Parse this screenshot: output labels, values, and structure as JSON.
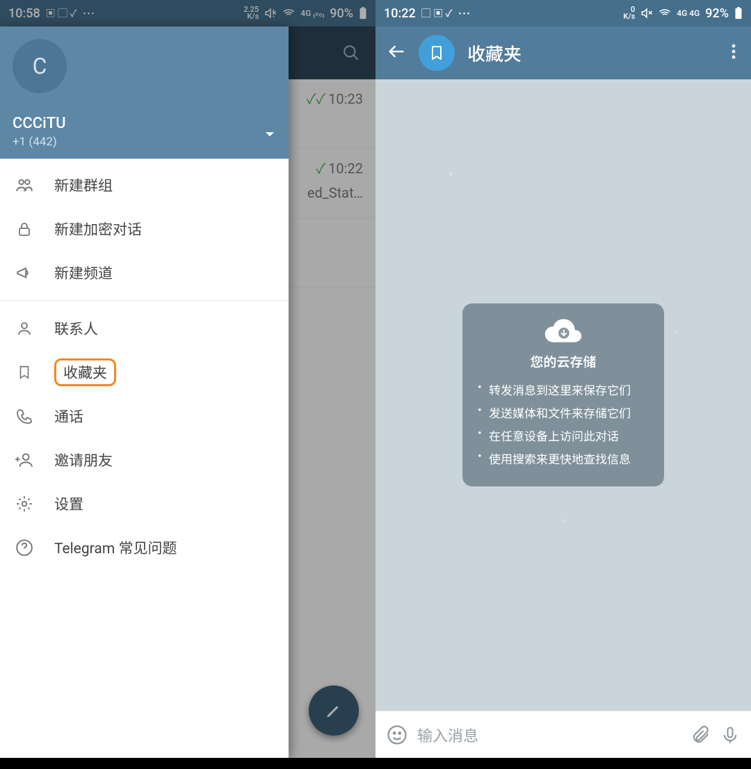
{
  "left": {
    "status": {
      "time": "10:58",
      "speed_top": "2.25",
      "speed_bot": "K/s",
      "net": "4G",
      "battery": "90%",
      "dots": "⋯"
    },
    "bg": {
      "row1_time": "10:23",
      "row2_time": "10:22",
      "row2_text": "ed_Stat…"
    },
    "account": {
      "avatar_letter": "C",
      "name": "CCCiTU",
      "phone": "+1 (442)"
    },
    "menu": {
      "new_group": "新建群组",
      "new_secret": "新建加密对话",
      "new_channel": "新建频道",
      "contacts": "联系人",
      "saved": "收藏夹",
      "calls": "通话",
      "invite": "邀请朋友",
      "settings": "设置",
      "faq": "Telegram 常见问题"
    }
  },
  "right": {
    "status": {
      "time": "10:22",
      "speed_top": "0",
      "speed_bot": "K/s",
      "net": "4G",
      "battery": "92%",
      "dots": "⋯"
    },
    "header": {
      "title": "收藏夹"
    },
    "card": {
      "title": "您的云存储",
      "items": [
        "转发消息到这里来保存它们",
        "发送媒体和文件来存储它们",
        "在任意设备上访问此对话",
        "使用搜索来更快地查找信息"
      ]
    },
    "input_placeholder": "输入消息"
  }
}
